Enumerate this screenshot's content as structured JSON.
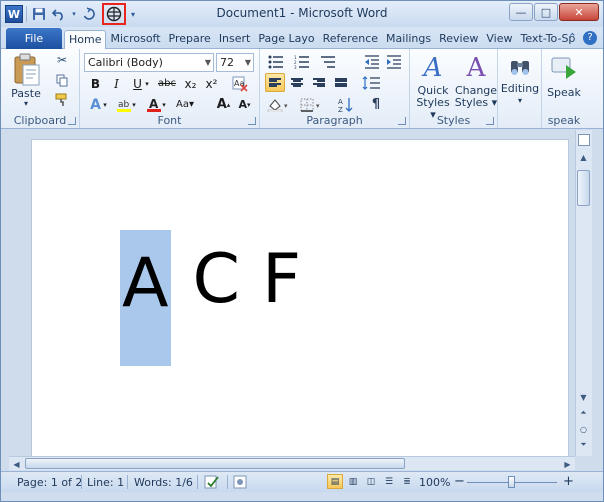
{
  "window": {
    "title": "Document1 - Microsoft Word",
    "app_icon_letter": "W",
    "controls": {
      "minimize": "—",
      "maximize": "□",
      "close": "✕"
    }
  },
  "ribbon_tabs": {
    "file": "File",
    "items": [
      "Home",
      "Microsoft",
      "Prepare",
      "Insert",
      "Page Layo",
      "Reference",
      "Mailings",
      "Review",
      "View",
      "Text-To-Sp"
    ],
    "active": "Home",
    "help_icon": "?"
  },
  "clipboard": {
    "paste_label": "Paste",
    "group_label": "Clipboard"
  },
  "font": {
    "name": "Calibri (Body)",
    "size": "72",
    "bold": "B",
    "italic": "I",
    "underline": "U",
    "strike": "abc",
    "subscript": "x₂",
    "superscript": "x²",
    "grow": "A",
    "shrink": "A",
    "group_label": "Font"
  },
  "paragraph": {
    "group_label": "Paragraph",
    "show_marks": "¶",
    "sort": "A↓"
  },
  "styles": {
    "quick_styles": "Quick\nStyles",
    "quick_line1": "Quick",
    "quick_line2": "Styles ▾",
    "change_line1": "Change",
    "change_line2": "Styles ▾",
    "group_label": "Styles"
  },
  "editing": {
    "label": "Editing",
    "caret": "▾"
  },
  "speak": {
    "label": "Speak",
    "group_label": "speak"
  },
  "document": {
    "selected_char": "A",
    "chars": [
      "C",
      "F"
    ]
  },
  "statusbar": {
    "page": "Page: 1 of 2",
    "line": "Line: 1",
    "words": "Words: 1/6",
    "zoom": "100%",
    "zoom_value_percent": 100,
    "zoom_out": "−",
    "zoom_in": "+"
  }
}
